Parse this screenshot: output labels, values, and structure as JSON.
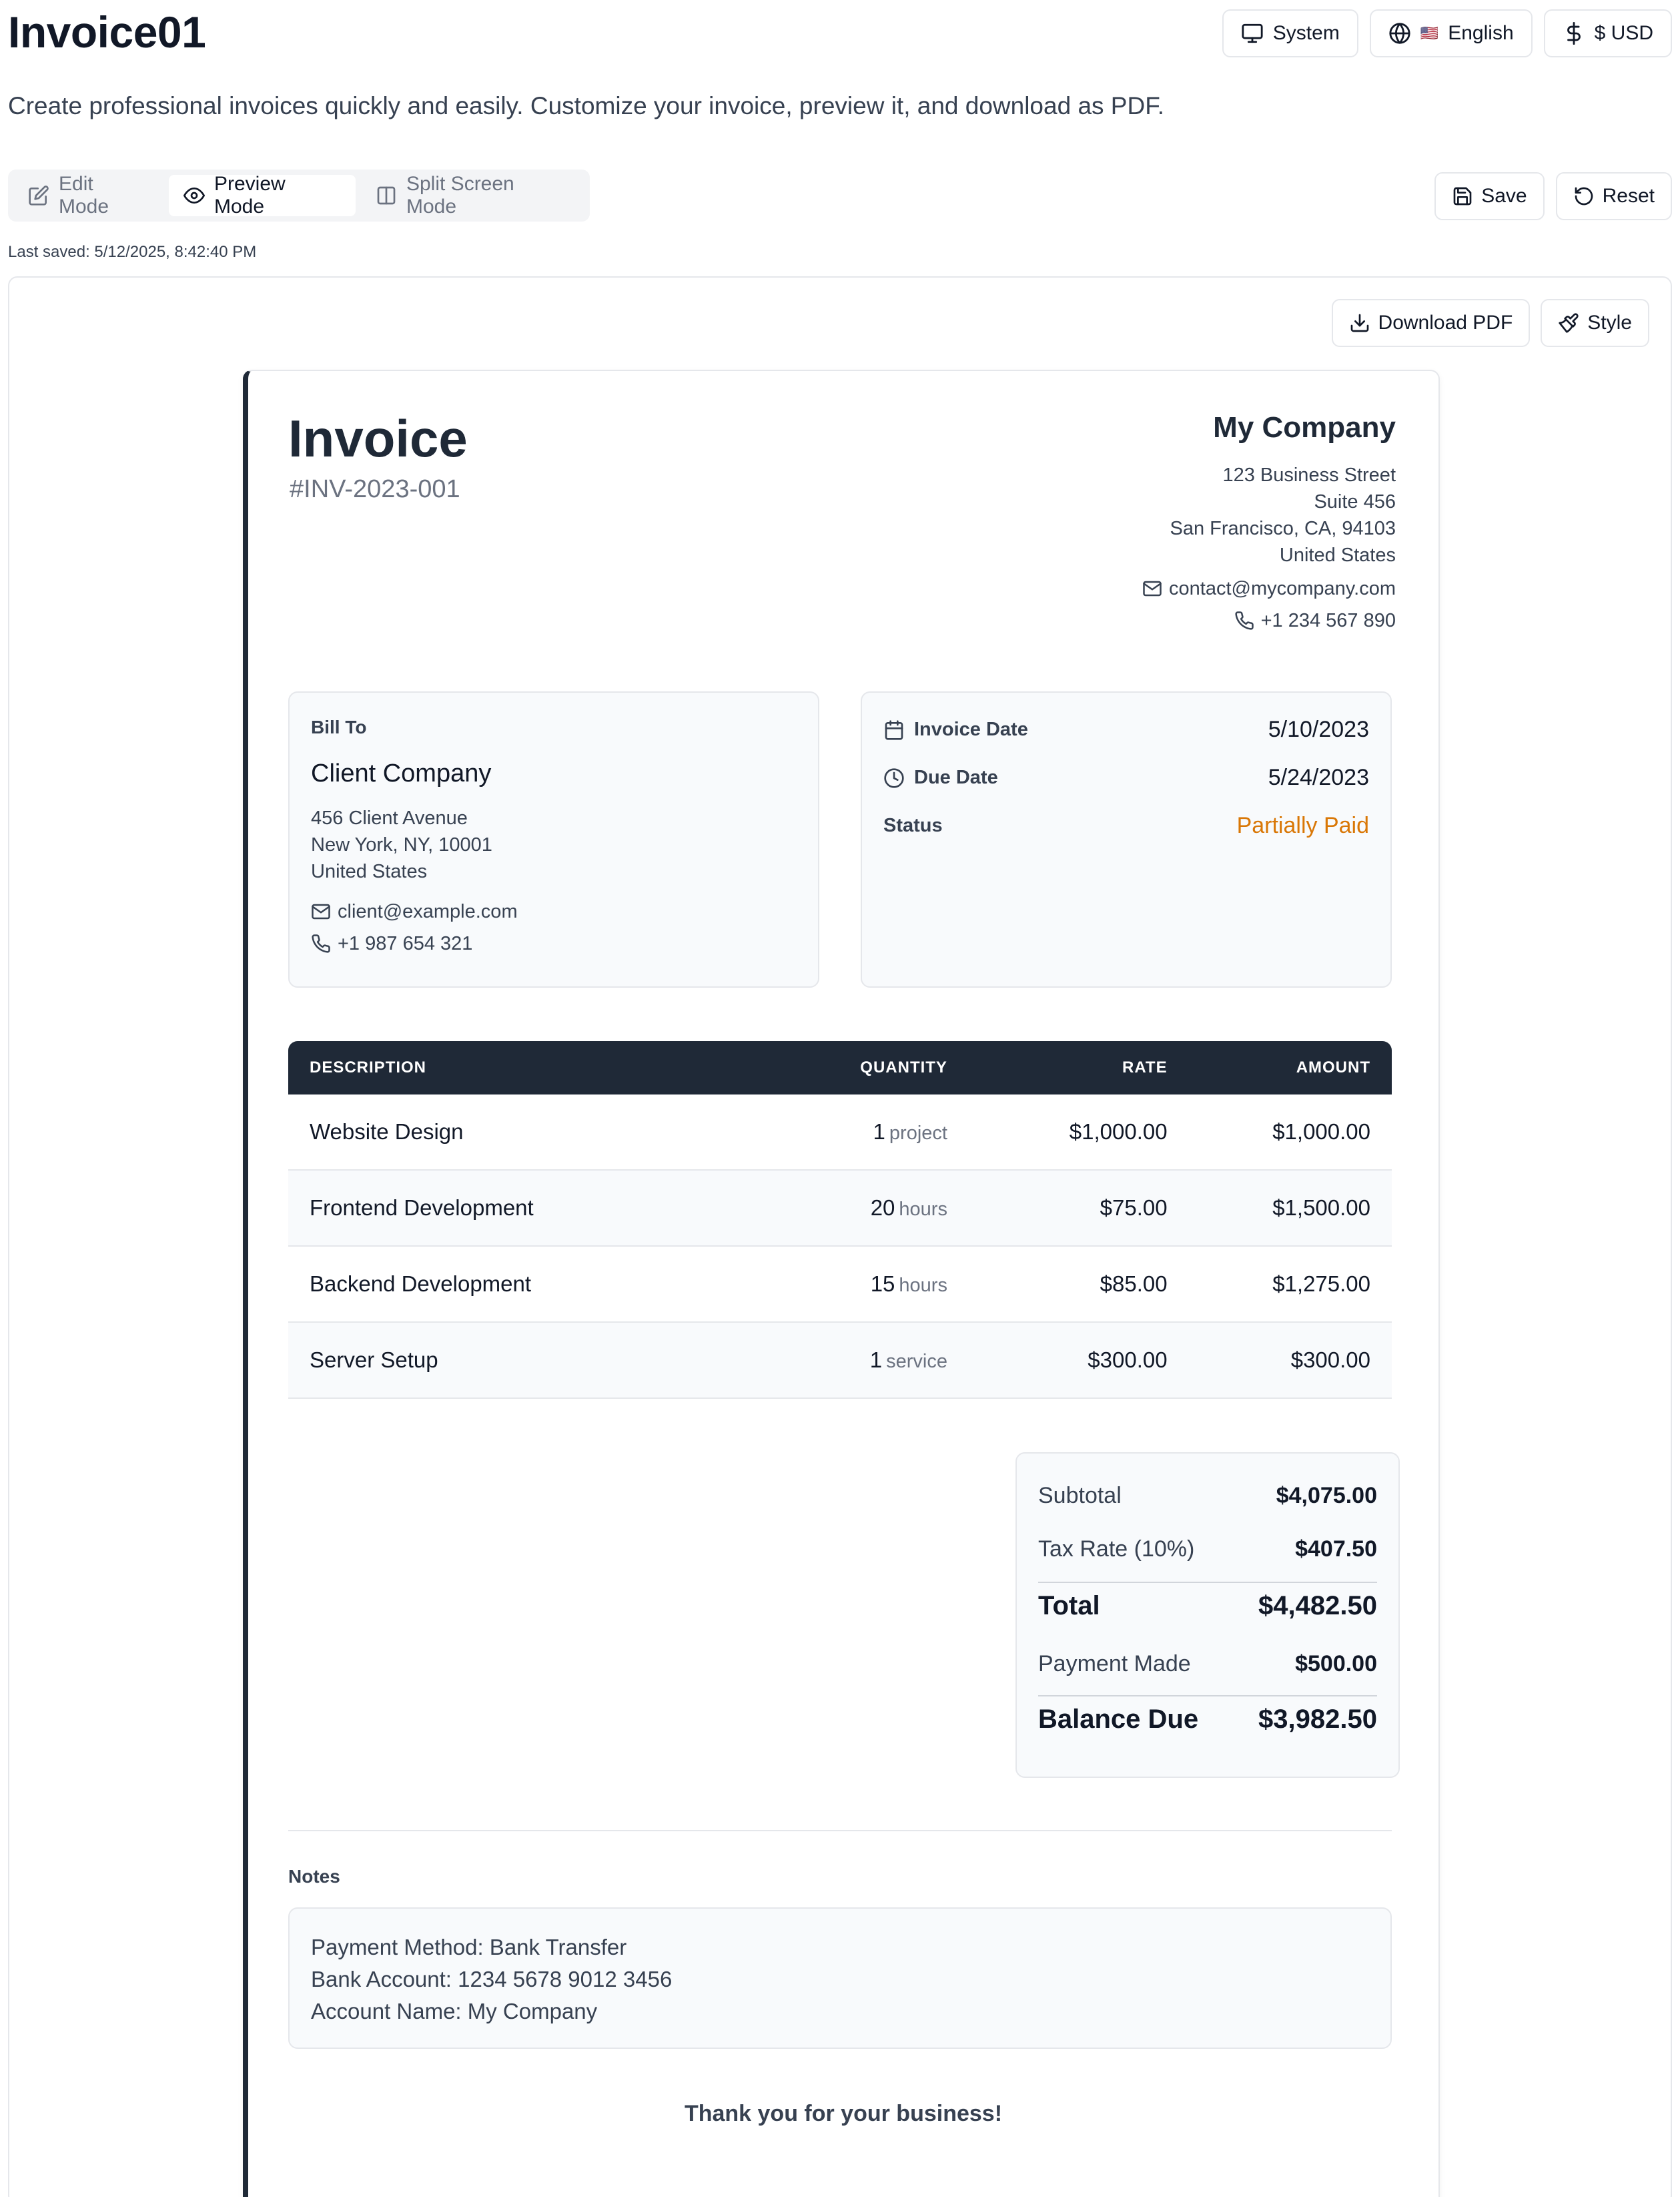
{
  "app": {
    "title": "Invoice01",
    "subtitle": "Create professional invoices quickly and easily. Customize your invoice, preview it, and download as PDF.",
    "last_saved": "Last saved: 5/12/2025, 8:42:40 PM"
  },
  "top_controls": {
    "theme": "System",
    "language_flag": "🇺🇸",
    "language": "English",
    "currency": "$ USD"
  },
  "modes": [
    {
      "label": "Edit Mode",
      "icon": "edit-icon",
      "active": false
    },
    {
      "label": "Preview Mode",
      "icon": "eye-icon",
      "active": true
    },
    {
      "label": "Split Screen Mode",
      "icon": "columns-icon",
      "active": false
    }
  ],
  "actions": {
    "save": "Save",
    "reset": "Reset",
    "download_pdf": "Download PDF",
    "style": "Style"
  },
  "invoice": {
    "title": "Invoice",
    "number": "#INV-2023-001",
    "company": {
      "name": "My Company",
      "address": [
        "123 Business Street",
        "Suite 456",
        "San Francisco, CA, 94103",
        "United States"
      ],
      "email": "contact@mycompany.com",
      "phone": "+1 234 567 890"
    },
    "bill_to": {
      "label": "Bill To",
      "name": "Client Company",
      "address": [
        "456 Client Avenue",
        "New York, NY, 10001",
        "United States"
      ],
      "email": "client@example.com",
      "phone": "+1 987 654 321"
    },
    "dates": {
      "invoice_date_label": "Invoice Date",
      "invoice_date": "5/10/2023",
      "due_date_label": "Due Date",
      "due_date": "5/24/2023",
      "status_label": "Status",
      "status": "Partially Paid",
      "status_color": "#d97706"
    },
    "table": {
      "headers": {
        "description": "DESCRIPTION",
        "quantity": "QUANTITY",
        "rate": "RATE",
        "amount": "AMOUNT"
      },
      "rows": [
        {
          "description": "Website Design",
          "qty": "1",
          "unit": "project",
          "rate": "$1,000.00",
          "amount": "$1,000.00"
        },
        {
          "description": "Frontend Development",
          "qty": "20",
          "unit": "hours",
          "rate": "$75.00",
          "amount": "$1,500.00"
        },
        {
          "description": "Backend Development",
          "qty": "15",
          "unit": "hours",
          "rate": "$85.00",
          "amount": "$1,275.00"
        },
        {
          "description": "Server Setup",
          "qty": "1",
          "unit": "service",
          "rate": "$300.00",
          "amount": "$300.00"
        }
      ]
    },
    "totals": {
      "subtotal_label": "Subtotal",
      "subtotal": "$4,075.00",
      "tax_label": "Tax Rate (10%)",
      "tax": "$407.50",
      "total_label": "Total",
      "total": "$4,482.50",
      "payment_label": "Payment Made",
      "payment": "$500.00",
      "balance_label": "Balance Due",
      "balance": "$3,982.50"
    },
    "notes": {
      "label": "Notes",
      "lines": [
        "Payment Method: Bank Transfer",
        "Bank Account: 1234 5678 9012 3456",
        "Account Name: My Company"
      ]
    },
    "footer": "Thank you for your business!"
  },
  "colors": {
    "header_dark": "#1f2937",
    "accent_status": "#d97706",
    "panel_bg": "#f8fafc"
  }
}
